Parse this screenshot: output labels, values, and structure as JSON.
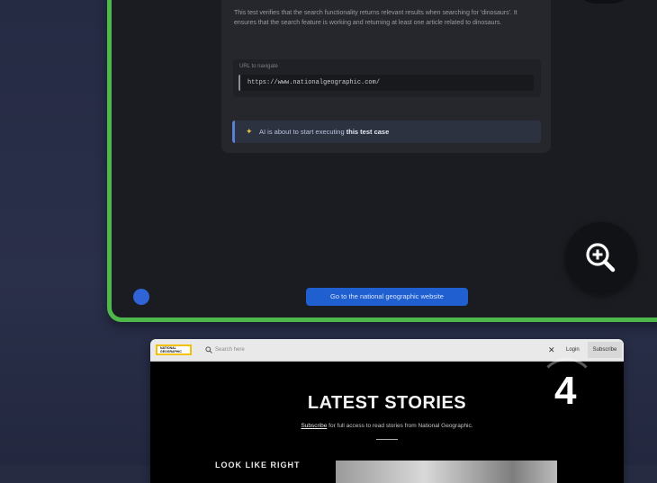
{
  "step3": {
    "description": "This test verifies that the search functionality returns relevant results when searching for 'dinosaurs'. It ensures that the search feature is working and returning at least one article related to dinosaurs.",
    "url_label": "URL to navigate",
    "url_value": "https://www.nationalgeographic.com/",
    "ai_status_lead": "AI is about to start executing",
    "ai_status_bold": "this test case",
    "go_button_label": "Go to the national geographic website"
  },
  "step4": {
    "logo_line1": "NATIONAL",
    "logo_line2": "GEOGRAPHIC",
    "search_placeholder": "Search here",
    "login_label": "Login",
    "subscribe_label": "Subscribe",
    "headline": "LATEST STORIES",
    "subline_link": "Subscribe",
    "subline_rest": " for full access to read stories from National Geographic.",
    "story_title": "LOOK LIKE RIGHT",
    "step_number": "4"
  },
  "colors": {
    "highlight_border": "#4fb84a",
    "primary_button": "#1f5fd0",
    "background": "#262b42"
  },
  "icons": [
    "zoom-in-icon",
    "sparkle-icon",
    "search-icon",
    "close-icon"
  ]
}
